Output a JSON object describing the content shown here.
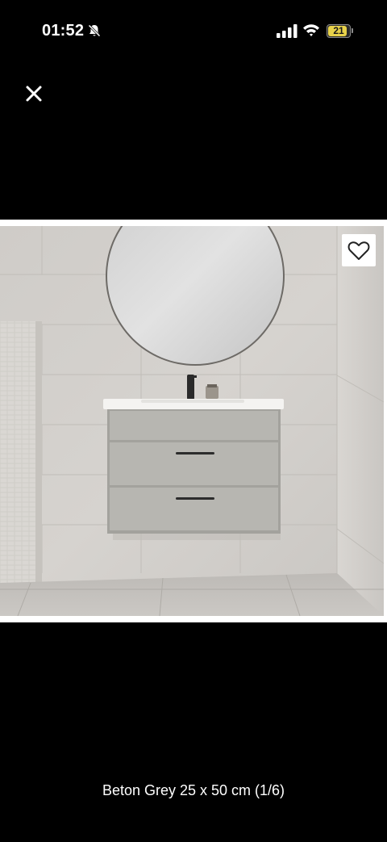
{
  "status_bar": {
    "time": "01:52",
    "battery_level": "21",
    "battery_fraction": 0.21,
    "battery_color": "#e8d24a",
    "icons": [
      "bell-slash-icon",
      "cellular-signal-icon",
      "wifi-icon",
      "battery-icon"
    ]
  },
  "viewer": {
    "close_icon": "close-icon",
    "favorite_icon": "heart-icon",
    "image_alt": "Beton Grey 25 x 50 cm",
    "caption": "Beton Grey 25 x 50 cm (1/6)"
  },
  "colors": {
    "background": "#000000",
    "tile": "#d3d0cc"
  }
}
